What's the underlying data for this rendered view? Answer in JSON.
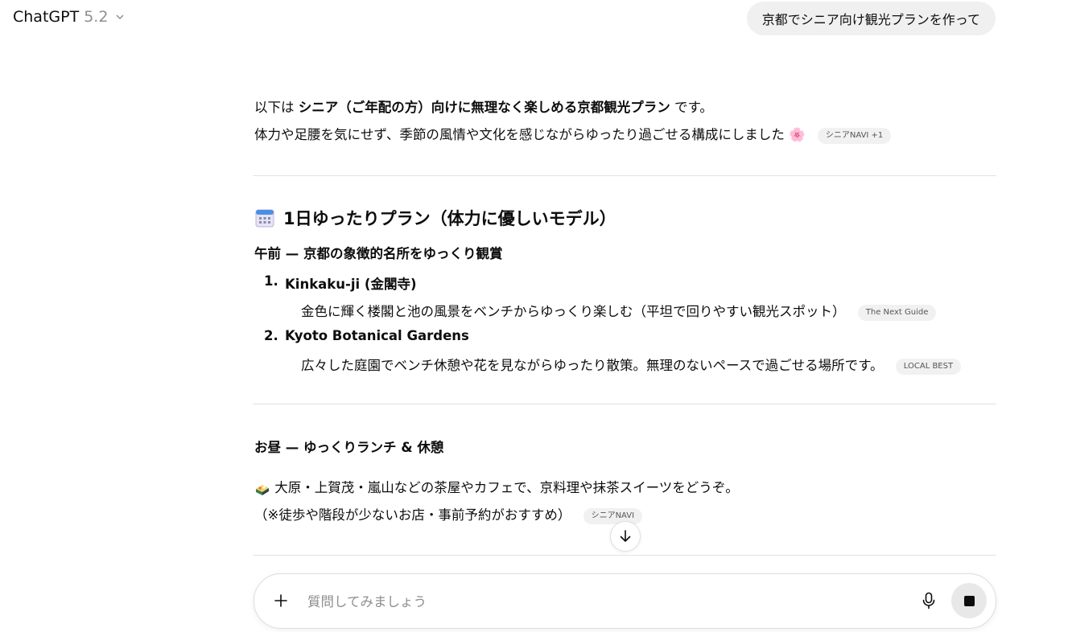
{
  "header": {
    "model_name": "ChatGPT",
    "model_version": "5.2"
  },
  "user_message": "京都でシニア向け観光プランを作って",
  "assistant": {
    "intro_prefix": "以下は",
    "intro_bold": "シニア（ご年配の方）向けに無理なく楽しめる京都観光プラン",
    "intro_suffix": "です。",
    "intro_line2": "体力や足腰を気にせず、季節の風情や文化を感じながらゆったり過ごせる構成にしました",
    "intro_emoji": "🌸",
    "intro_citation": "シニアNAVI +1",
    "plan_title": "1日ゆったりプラン（体力に優しいモデル）",
    "morning_heading": "午前 — 京都の象徴的名所をゆっくり観賞",
    "items": [
      {
        "num": "1.",
        "title": "Kinkaku-ji (金閣寺)",
        "desc": "金色に輝く楼閣と池の風景をベンチからゆっくり楽しむ（平坦で回りやすい観光スポット）",
        "citation": "The Next Guide"
      },
      {
        "num": "2.",
        "title": "Kyoto Botanical Gardens",
        "desc": "広々した庭園でベンチ休憩や花を見ながらゆったり散策。無理のないペースで過ごせる場所です。",
        "citation": "LOCAL BEST"
      }
    ],
    "lunch_heading": "お昼 — ゆっくりランチ & 休憩",
    "lunch_line1": "大原・上賀茂・嵐山などの茶屋やカフェで、京料理や抹茶スイーツをどうぞ。",
    "lunch_line2": "（※徒歩や階段が少ないお店・事前予約がおすすめ）",
    "lunch_citation": "シニアNAVI"
  },
  "composer": {
    "placeholder": "質問してみましょう"
  },
  "icons": {
    "model": "chevron-down-icon",
    "plan": "calendar-icon",
    "lunch": "bento-icon",
    "scroll": "arrow-down-icon",
    "add": "plus-icon",
    "mic": "microphone-icon",
    "stop": "stop-icon"
  }
}
